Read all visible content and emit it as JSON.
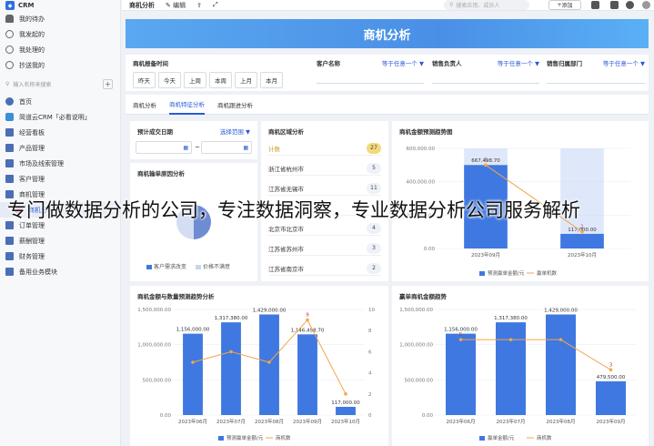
{
  "sidebar": {
    "app_name": "CRM",
    "items_top": [
      "我的待办",
      "我发起的",
      "我处理的",
      "抄送我的"
    ],
    "search_placeholder": "输入名称来搜索",
    "nav": [
      "首页",
      "简道云CRM「必看说明」",
      "经营看板",
      "产品管理",
      "市场及线索管理",
      "客户管理",
      "商机管理"
    ],
    "sub_active": "商机分析",
    "nav_bottom": [
      "订单管理",
      "薪酬管理",
      "财务管理",
      "备用业务模块"
    ]
  },
  "topbar": {
    "title": "商机分析",
    "edit_label": "编辑",
    "search_placeholder": "搜索应用、成员人",
    "add_label": "添加"
  },
  "banner": {
    "title": "商机分析"
  },
  "filters": {
    "time_label": "商机报备时间",
    "time_chips": [
      "昨天",
      "今天",
      "上周",
      "本周",
      "上月",
      "本月"
    ],
    "customer_label": "客户名称",
    "customer_value": "等于任意一个 ▼",
    "owner_label": "销售负责人",
    "owner_value": "等于任意一个 ▼",
    "dept_label": "销售归属部门",
    "dept_value": "等于任意一个 ▼"
  },
  "tabs": [
    "商机分析",
    "商机特征分析",
    "商机跟进分析"
  ],
  "predict": {
    "title": "预计成交日期",
    "range_label": "选择范围 ▼",
    "sep": "~"
  },
  "loss": {
    "title": "商机输单原因分析",
    "legend": [
      "客户需求改变",
      "价格不满意"
    ]
  },
  "region": {
    "title": "商机区域分析",
    "rows": [
      {
        "name": "计数",
        "count": "27"
      },
      {
        "name": "浙江省杭州市",
        "count": "5"
      },
      {
        "name": "江苏省无锡市",
        "count": "11"
      },
      {
        "name": "",
        "count": ""
      },
      {
        "name": "北京市北京市",
        "count": "4"
      },
      {
        "name": "江苏省苏州市",
        "count": "3"
      },
      {
        "name": "江苏省南京市",
        "count": "2"
      }
    ]
  },
  "chart_data": [
    {
      "type": "bar",
      "title": "商机金额预测趋势图",
      "categories": [
        "2023年09月",
        "2023年10月"
      ],
      "series": [
        {
          "name": "预测赢单金额/元",
          "values": [
            667498.7,
            117000.0
          ]
        },
        {
          "name": "赢单机数",
          "values": [
            5,
            1
          ]
        }
      ],
      "bar_labels": [
        "667,498.70",
        "117,000.00"
      ],
      "ylim": [
        0,
        800000
      ],
      "yticks": [
        "0.00",
        "200,000.00",
        "400,000.00",
        "600,000.00"
      ]
    },
    {
      "type": "bar",
      "title": "商机金额与数量预测趋势分析",
      "categories": [
        "2023年06月",
        "2023年07月",
        "2023年08月",
        "2023年09月",
        "2023年10月"
      ],
      "series": [
        {
          "name": "预测赢单金额/元",
          "values": [
            1156000.0,
            1317380.0,
            1429000.0,
            1146498.7,
            117000.0
          ]
        },
        {
          "name": "商机数",
          "values": [
            5,
            6,
            5,
            9,
            2
          ]
        }
      ],
      "bar_labels": [
        "1,156,000.00",
        "1,317,380.00",
        "1,429,000.00",
        "1,146,498.70",
        "117,000.00"
      ],
      "line_labels": [
        "",
        "",
        "",
        "9",
        ""
      ],
      "ylim": [
        0,
        1500000
      ],
      "yticks": [
        "0.00",
        "500,000.00",
        "1,000,000.00",
        "1,500,000.00"
      ],
      "y2ticks": [
        "0",
        "2",
        "4",
        "6",
        "8",
        "10"
      ]
    },
    {
      "type": "bar",
      "title": "赢单商机金额趋势",
      "categories": [
        "2023年06月",
        "2023年07月",
        "2023年08月",
        "2023年09月"
      ],
      "series": [
        {
          "name": "赢单金额/元",
          "values": [
            1156000.0,
            1317380.0,
            1429000.0,
            479500.0
          ]
        },
        {
          "name": "商机数",
          "values": [
            5,
            5,
            5,
            3
          ]
        }
      ],
      "bar_labels": [
        "1,156,000.00",
        "1,317,380.00",
        "1,429,000.00",
        "479,500.00"
      ],
      "line_labels": [
        "5",
        "",
        "",
        "3"
      ],
      "ylim": [
        0,
        1500000
      ],
      "yticks": [
        "0.00",
        "500,000.00",
        "1,000,000.00",
        "1,500,000.00"
      ]
    }
  ],
  "overlay_text": "专门做数据分析的公司，专注数据洞察，专业数据分析公司服务解析",
  "colors": {
    "primary": "#2a5bd7",
    "bar": "#3f78e0",
    "line": "#f0a64a",
    "banner": "#4a8fe6"
  }
}
